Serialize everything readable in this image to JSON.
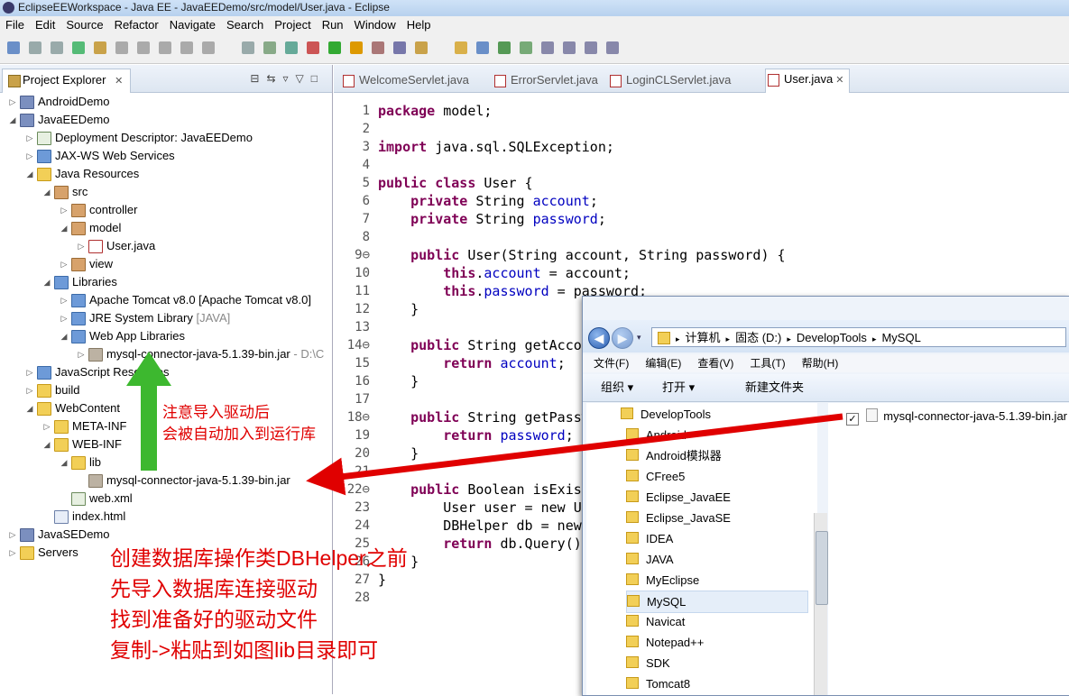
{
  "window": {
    "title": "EclipseEEWorkspace - Java EE - JavaEEDemo/src/model/User.java - Eclipse"
  },
  "menu": [
    "File",
    "Edit",
    "Source",
    "Refactor",
    "Navigate",
    "Search",
    "Project",
    "Run",
    "Window",
    "Help"
  ],
  "explorer": {
    "tab_label": "Project Explorer",
    "tree": [
      {
        "label": "AndroidDemo",
        "level": 0,
        "tw": "▷",
        "icon": "ic-proj",
        "name": "tree-android-demo"
      },
      {
        "label": "JavaEEDemo",
        "level": 0,
        "tw": "◢",
        "icon": "ic-proj",
        "name": "tree-javaee-demo"
      },
      {
        "label": "Deployment Descriptor: JavaEEDemo",
        "level": 1,
        "tw": "▷",
        "icon": "ic-xml",
        "name": "tree-deployment-descriptor"
      },
      {
        "label": "JAX-WS Web Services",
        "level": 1,
        "tw": "▷",
        "icon": "ic-lib",
        "name": "tree-jaxws"
      },
      {
        "label": "Java Resources",
        "level": 1,
        "tw": "◢",
        "icon": "ic-folder",
        "name": "tree-java-resources"
      },
      {
        "label": "src",
        "level": 2,
        "tw": "◢",
        "icon": "ic-pkg",
        "name": "tree-src"
      },
      {
        "label": "controller",
        "level": 3,
        "tw": "▷",
        "icon": "ic-pkg",
        "name": "tree-controller"
      },
      {
        "label": "model",
        "level": 3,
        "tw": "◢",
        "icon": "ic-pkg",
        "name": "tree-model"
      },
      {
        "label": "User.java",
        "level": 4,
        "tw": "▷",
        "icon": "ic-java",
        "name": "tree-user-java"
      },
      {
        "label": "view",
        "level": 3,
        "tw": "▷",
        "icon": "ic-pkg",
        "name": "tree-view"
      },
      {
        "label": "Libraries",
        "level": 2,
        "tw": "◢",
        "icon": "ic-lib",
        "name": "tree-libraries"
      },
      {
        "label": "Apache Tomcat v8.0 [Apache Tomcat v8.0]",
        "level": 3,
        "tw": "▷",
        "icon": "ic-lib",
        "name": "tree-tomcat-lib"
      },
      {
        "label": "JRE System Library",
        "suffix": " [JAVA]",
        "level": 3,
        "tw": "▷",
        "icon": "ic-lib",
        "name": "tree-jre-lib"
      },
      {
        "label": "Web App Libraries",
        "level": 3,
        "tw": "◢",
        "icon": "ic-lib",
        "name": "tree-webapp-lib"
      },
      {
        "label": "mysql-connector-java-5.1.39-bin.jar",
        "suffix": " - D:\\C",
        "level": 4,
        "tw": "▷",
        "icon": "ic-jar",
        "name": "tree-webapp-mysql-jar"
      },
      {
        "label": "JavaScript Resources",
        "level": 1,
        "tw": "▷",
        "icon": "ic-lib",
        "name": "tree-js-resources"
      },
      {
        "label": "build",
        "level": 1,
        "tw": "▷",
        "icon": "ic-folder",
        "name": "tree-build"
      },
      {
        "label": "WebContent",
        "level": 1,
        "tw": "◢",
        "icon": "ic-folder",
        "name": "tree-webcontent"
      },
      {
        "label": "META-INF",
        "level": 2,
        "tw": "▷",
        "icon": "ic-folder",
        "name": "tree-meta-inf"
      },
      {
        "label": "WEB-INF",
        "level": 2,
        "tw": "◢",
        "icon": "ic-folder",
        "name": "tree-web-inf"
      },
      {
        "label": "lib",
        "level": 3,
        "tw": "◢",
        "icon": "ic-folder",
        "name": "tree-lib"
      },
      {
        "label": "mysql-connector-java-5.1.39-bin.jar",
        "level": 4,
        "tw": "",
        "icon": "ic-jar",
        "name": "tree-lib-mysql-jar"
      },
      {
        "label": "web.xml",
        "level": 3,
        "tw": "",
        "icon": "ic-xml",
        "name": "tree-web-xml"
      },
      {
        "label": "index.html",
        "level": 2,
        "tw": "",
        "icon": "ic-html",
        "name": "tree-index-html"
      },
      {
        "label": "JavaSEDemo",
        "level": 0,
        "tw": "▷",
        "icon": "ic-proj",
        "name": "tree-javase-demo"
      },
      {
        "label": "Servers",
        "level": 0,
        "tw": "▷",
        "icon": "ic-folder",
        "name": "tree-servers"
      }
    ]
  },
  "editor": {
    "tabs": [
      {
        "label": "WelcomeServlet.java",
        "active": false
      },
      {
        "label": "ErrorServlet.java",
        "active": false
      },
      {
        "label": "LoginCLServlet.java",
        "active": false
      },
      {
        "label": "User.java",
        "active": true
      }
    ],
    "line_numbers": [
      "1",
      "2",
      "3",
      "4",
      "5",
      "6",
      "7",
      "8",
      "9⊖",
      "10",
      "11",
      "12",
      "13",
      "14⊖",
      "15",
      "16",
      "17",
      "18⊖",
      "19",
      "20",
      "21",
      "22⊖",
      "23",
      "24",
      "25",
      "26",
      "27",
      "28"
    ],
    "lines": [
      "<span class=\"kw\">package</span> model;",
      "",
      "<span class=\"kw\">import</span> java.sql.SQLException;",
      "",
      "<span class=\"kw\">public class</span> User {",
      "    <span class=\"kw\">private</span> String <span class=\"fld\">account</span>;",
      "    <span class=\"kw\">private</span> String <span class=\"fld\">password</span>;",
      "",
      "    <span class=\"kw\">public</span> User(String account, String password) {",
      "        <span class=\"kw\">this</span>.<span class=\"fld\">account</span> = account;",
      "        <span class=\"kw\">this</span>.<span class=\"fld\">password</span> = password;",
      "    }",
      "",
      "    <span class=\"kw\">public</span> String getAccount() {",
      "        <span class=\"kw\">return</span> <span class=\"fld\">account</span>;",
      "    }",
      "",
      "    <span class=\"kw\">public</span> String getPassword() {",
      "        <span class=\"kw\">return</span> <span class=\"fld\">password</span>;",
      "    }",
      "",
      "    <span class=\"kw\">public</span> Boolean isExist() {",
      "        User user = new User();",
      "        DBHelper db = new DBHelper();",
      "        <span class=\"kw\">return</span> db.Query();",
      "    }",
      "}",
      ""
    ]
  },
  "explorer_dialog": {
    "path": [
      "计算机",
      "固态 (D:)",
      "DevelopTools",
      "MySQL"
    ],
    "menu": [
      "文件(F)",
      "编辑(E)",
      "查看(V)",
      "工具(T)",
      "帮助(H)"
    ],
    "toolbar": {
      "organize": "组织 ▾",
      "open": "打开 ▾",
      "new_folder": "新建文件夹"
    },
    "nav_root": "DevelopTools",
    "nav_items": [
      "Android",
      "Android模拟器",
      "CFree5",
      "Eclipse_JavaEE",
      "Eclipse_JavaSE",
      "IDEA",
      "JAVA",
      "MyEclipse",
      "MySQL",
      "Navicat",
      "Notepad++",
      "SDK",
      "Tomcat8"
    ],
    "selected_item": "MySQL",
    "file": "mysql-connector-java-5.1.39-bin.jar"
  },
  "annotations": {
    "green_note": [
      "注意导入驱动后",
      "会被自动加入到运行库"
    ],
    "red_note": [
      "创建数据库操作类DBHelper之前",
      "先导入数据库连接驱动",
      "找到准备好的驱动文件",
      "复制->粘贴到如图lib目录即可"
    ]
  },
  "colors": {
    "note_red": "#e00000",
    "arrow_green": "#3db82f",
    "keyword": "#7f0055",
    "field": "#0000c0"
  }
}
